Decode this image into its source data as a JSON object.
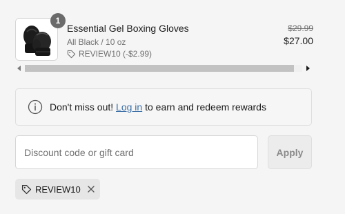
{
  "product": {
    "title": "Essential Gel Boxing Gloves",
    "variant": "All Black / 10 oz",
    "discount_code": "REVIEW10 (-$2.99)",
    "original_price": "$29.99",
    "price": "$27.00",
    "quantity": "1",
    "image": "black-boxing-gloves"
  },
  "scrollbar": {
    "thumb_fraction": 0.97
  },
  "rewards": {
    "prefix": "Don't miss out! ",
    "link_label": "Log in",
    "suffix": " to earn and redeem rewards",
    "icon": "info-icon"
  },
  "discount": {
    "placeholder": "Discount code or gift card",
    "value": "",
    "apply_label": "Apply"
  },
  "applied_code": {
    "label": "REVIEW10",
    "icon": "tag-icon",
    "remove_icon": "close-icon"
  },
  "colors": {
    "background": "#f5f5f5",
    "link": "#3a6ea5",
    "muted_text": "#707070",
    "badge": "#6b6b6b"
  }
}
